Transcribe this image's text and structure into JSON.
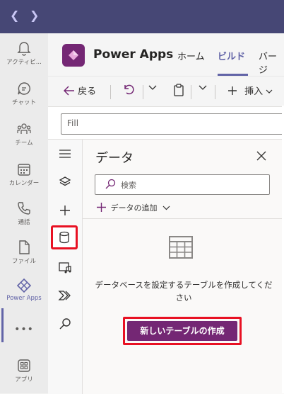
{
  "teams": {
    "nav": {
      "back_icon": "chevron-left-icon",
      "forward_icon": "chevron-right-icon"
    },
    "rail": [
      {
        "label": "アクティビ...",
        "icon": "bell-icon"
      },
      {
        "label": "チャット",
        "icon": "chat-icon"
      },
      {
        "label": "チーム",
        "icon": "teams-icon"
      },
      {
        "label": "カレンダー",
        "icon": "calendar-icon"
      },
      {
        "label": "通話",
        "icon": "phone-icon"
      },
      {
        "label": "ファイル",
        "icon": "file-icon"
      },
      {
        "label": "Power Apps",
        "icon": "power-apps-icon"
      },
      {
        "label": "アプリ",
        "icon": "apps-icon"
      }
    ],
    "more_label": "•••"
  },
  "app": {
    "title": "Power Apps",
    "tabs": [
      {
        "label": "ホーム",
        "active": false
      },
      {
        "label": "ビルド",
        "active": true
      },
      {
        "label": "バージ",
        "active": false
      }
    ],
    "brand_color": "#742774",
    "accent_color": "#6264a7"
  },
  "toolbar": {
    "back_label": "戻る",
    "insert_label": "挿入"
  },
  "formula": {
    "value": "Fill"
  },
  "tools": [
    "menu-icon",
    "layers-icon",
    "plus-icon",
    "database-icon",
    "media-icon",
    "power-automate-icon",
    "search-icon"
  ],
  "panel": {
    "title": "データ",
    "search_placeholder": "検索",
    "add_data_label": "データの追加",
    "empty_message": "データベースを設定するテーブルを作成してください",
    "create_button_label": "新しいテーブルの作成"
  }
}
